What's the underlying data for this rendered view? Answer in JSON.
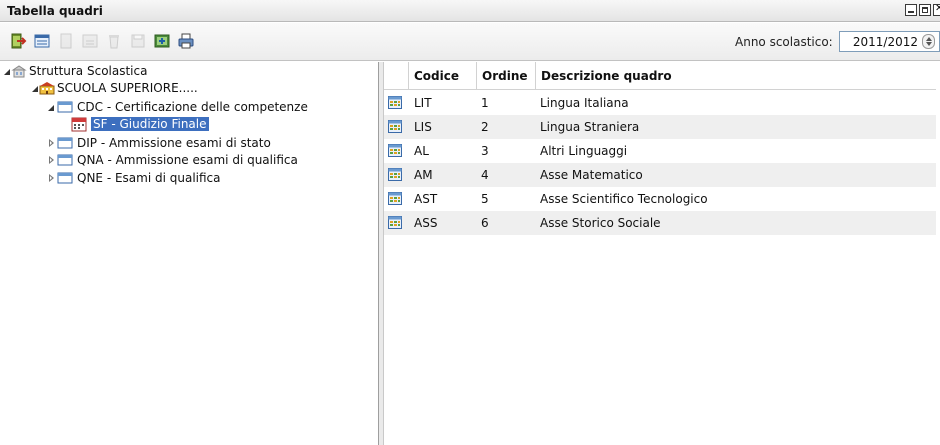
{
  "window": {
    "title": "Tabella quadri"
  },
  "toolbar": {
    "buttons": [
      {
        "icon": "exit-icon",
        "enabled": true
      },
      {
        "icon": "list-icon",
        "enabled": true
      },
      {
        "icon": "new-icon",
        "enabled": false
      },
      {
        "icon": "edit-icon",
        "enabled": false
      },
      {
        "icon": "delete-icon",
        "enabled": false
      },
      {
        "icon": "save-icon",
        "enabled": false
      },
      {
        "icon": "import-icon",
        "enabled": true
      },
      {
        "icon": "print-icon",
        "enabled": true
      }
    ],
    "year_label": "Anno scolastico:",
    "year_value": "2011/2012"
  },
  "tree": {
    "root": "Struttura Scolastica",
    "school": "SCUOLA SUPERIORE.....",
    "nodes": {
      "cdc": "CDC - Certificazione delle competenze",
      "sf": "SF - Giudizio Finale",
      "dip": "DIP - Ammissione esami di stato",
      "qna": "QNA - Ammissione esami di qualifica",
      "qne": "QNE - Esami di qualifica"
    }
  },
  "grid": {
    "columns": [
      "Codice",
      "Ordine",
      "Descrizione quadro"
    ],
    "rows": [
      {
        "codice": "LIT",
        "ordine": "1",
        "descrizione": "Lingua Italiana"
      },
      {
        "codice": "LIS",
        "ordine": "2",
        "descrizione": "Lingua Straniera"
      },
      {
        "codice": "AL",
        "ordine": "3",
        "descrizione": "Altri Linguaggi"
      },
      {
        "codice": "AM",
        "ordine": "4",
        "descrizione": "Asse Matematico"
      },
      {
        "codice": "AST",
        "ordine": "5",
        "descrizione": "Asse Scientifico Tecnologico"
      },
      {
        "codice": "ASS",
        "ordine": "6",
        "descrizione": "Asse Storico Sociale"
      }
    ]
  },
  "colors": {
    "selection": "#3d6fbf",
    "alt_row": "#efefef"
  }
}
